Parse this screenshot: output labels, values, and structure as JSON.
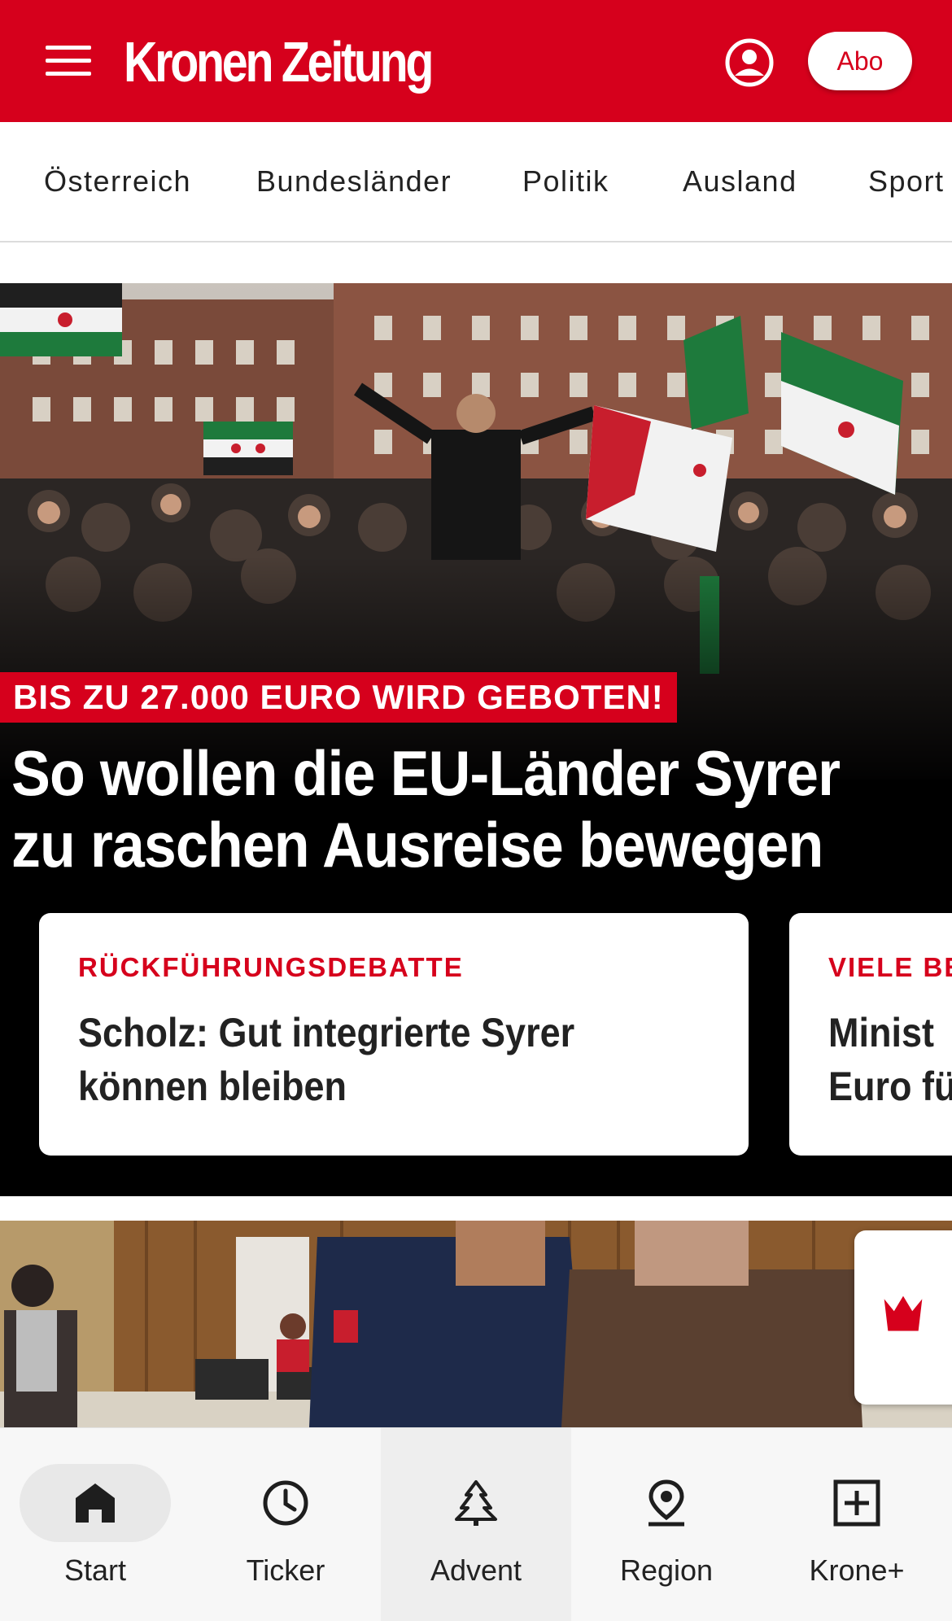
{
  "header": {
    "logo_text": "Kronen Zeitung",
    "abo_label": "Abo",
    "brand_color": "#d6001c",
    "menu_icon": "hamburger-menu-icon",
    "account_icon": "user-account-icon"
  },
  "categories": [
    "Österreich",
    "Bundesländer",
    "Politik",
    "Ausland",
    "Sport"
  ],
  "hero": {
    "kicker": "BIS ZU 27.000 EURO WIRD GEBOTEN!",
    "headline_line1": "So wollen die EU-Länder Syrer",
    "headline_line2": "zu raschen Ausreise bewegen"
  },
  "cards": [
    {
      "kicker": "RÜCKFÜHRUNGSDEBATTE",
      "title_line1": "Scholz: Gut integrierte Syrer",
      "title_line2": "können bleiben"
    },
    {
      "kicker": "VIELE BE",
      "title_line1": "Minist",
      "title_line2": "Euro fü"
    }
  ],
  "crown_icon": "krone-crown-icon",
  "bottom_nav": [
    {
      "label": "Start",
      "icon": "home-icon"
    },
    {
      "label": "Ticker",
      "icon": "clock-icon"
    },
    {
      "label": "Advent",
      "icon": "christmas-tree-icon"
    },
    {
      "label": "Region",
      "icon": "location-pin-icon"
    },
    {
      "label": "Krone+",
      "icon": "plus-box-icon"
    }
  ]
}
